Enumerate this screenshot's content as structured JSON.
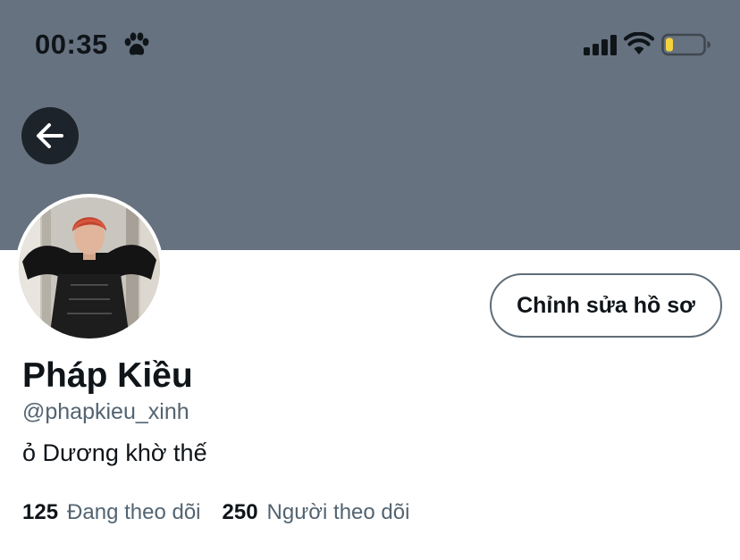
{
  "status_bar": {
    "time": "00:35",
    "icons": [
      "paw-icon",
      "cellular-signal-icon",
      "wifi-icon",
      "battery-icon"
    ],
    "battery_level": 0.2
  },
  "header": {
    "back_icon": "arrow-left-icon"
  },
  "profile": {
    "name": "Pháp Kiều",
    "handle": "@phapkieu_xinh",
    "bio": "ỏ Dương khờ thế",
    "edit_button_label": "Chỉnh sửa hồ sơ",
    "following_count": "125",
    "following_label": "Đang theo dõi",
    "followers_count": "250",
    "followers_label": "Người theo dõi"
  },
  "colors": {
    "banner": "#66727f",
    "text_primary": "#0f1419",
    "text_secondary": "#536471",
    "battery_fill": "#f5d33b"
  }
}
